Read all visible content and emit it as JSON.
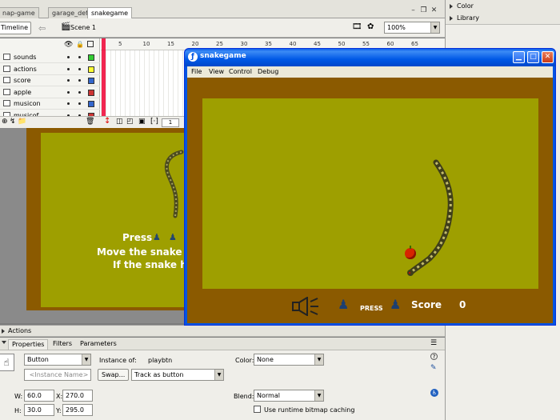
{
  "doc_tabs": [
    "nap-game",
    "garage_def_en",
    "snakegame"
  ],
  "timeline": {
    "button_label": "Timeline",
    "scene_label": "Scene 1",
    "zoom": "100%",
    "current_frame": "1",
    "ruler_numbers": [
      "5",
      "10",
      "15",
      "20",
      "25",
      "30",
      "35",
      "40",
      "45",
      "50",
      "55",
      "60",
      "65"
    ],
    "layers": [
      {
        "name": "sounds",
        "color": "#33cc33"
      },
      {
        "name": "actions",
        "color": "#ffff33"
      },
      {
        "name": "score",
        "color": "#3366cc"
      },
      {
        "name": "apple",
        "color": "#cc3333"
      },
      {
        "name": "musicon",
        "color": "#3366cc"
      },
      {
        "name": "musicof",
        "color": "#cc3333"
      }
    ]
  },
  "stage": {
    "press_text": "Press",
    "line1": "Move the snake to",
    "line2": "If the snake hits th"
  },
  "right_panels": [
    "Color",
    "Library"
  ],
  "actions_label": "Actions",
  "properties": {
    "tabs": [
      "Properties",
      "Filters",
      "Parameters"
    ],
    "symbol_type": "Button",
    "instance_name_placeholder": "<Instance Name>",
    "instance_of_label": "Instance of:",
    "instance_of_value": "playbtn",
    "swap_label": "Swap...",
    "track_mode": "Track as button",
    "color_label": "Color:",
    "color_value": "None",
    "blend_label": "Blend:",
    "blend_value": "Normal",
    "cache_label": "Use runtime bitmap caching",
    "w_label": "W:",
    "w_value": "60.0",
    "h_label": "H:",
    "h_value": "30.0",
    "x_label": "X:",
    "x_value": "270.0",
    "y_label": "Y:",
    "y_value": "295.0"
  },
  "player": {
    "title": "snakegame",
    "menu": [
      "File",
      "View",
      "Control",
      "Debug"
    ],
    "press_label": "PRESS",
    "score_label": "Score",
    "score_value": "0"
  },
  "colors": {
    "stage_border": "#8b5a00",
    "stage_field": "#9e9f00",
    "xp_title": "#0054e3"
  }
}
